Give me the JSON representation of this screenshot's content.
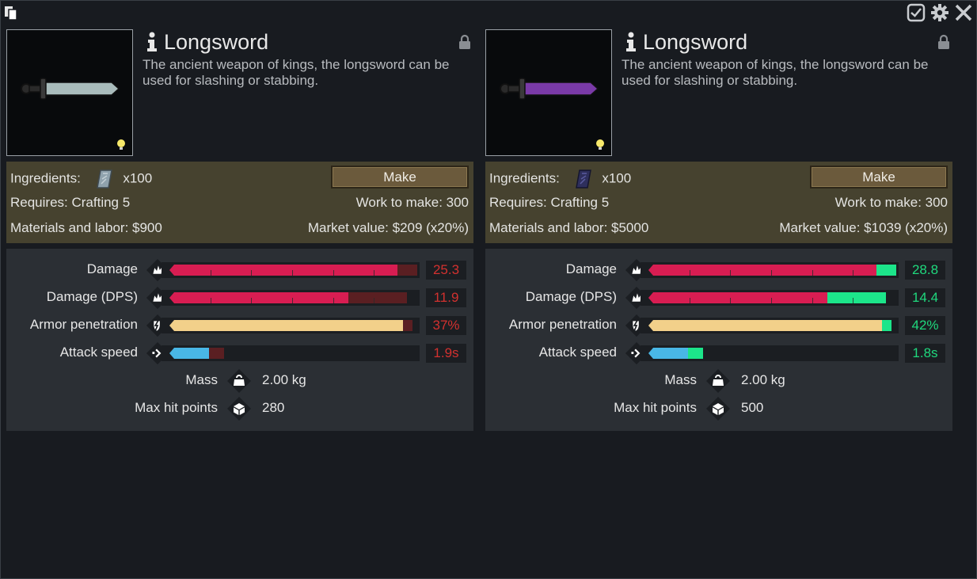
{
  "window": {
    "icons": [
      "copy-icon",
      "checklist-icon",
      "gear-icon",
      "close-icon"
    ]
  },
  "colors": {
    "damage": "#d81d52",
    "armor": "#f2d08a",
    "speed": "#49b7e6",
    "worse": "#5a1f22",
    "better": "#1ce58a",
    "worse_text": "#d2312f",
    "better_text": "#1fd87d",
    "craft_bg": "#46422f",
    "stats_bg": "#2b2f34"
  },
  "left": {
    "name": "Longsword",
    "description": "The ancient weapon of kings, the longsword can be used for slashing or stabbing.",
    "blade_color": "#a9bcbc",
    "ingredients_label": "Ingredients:",
    "ingredient_icon": "steel-icon",
    "ingredient_qty": "x100",
    "make_label": "Make",
    "requires": "Requires: Crafting 5",
    "work": "Work to make: 300",
    "materials": "Materials and labor: $900",
    "market": "Market value: $209 (x20%)",
    "stats": [
      {
        "label": "Damage",
        "icon": "damage-icon",
        "value": "25.3",
        "main": 0.93,
        "diff": 0.08,
        "diff_sign": "worse",
        "color": "damage"
      },
      {
        "label": "Damage (DPS)",
        "icon": "damage-icon",
        "value": "11.9",
        "main": 0.73,
        "diff": 0.24,
        "diff_sign": "worse",
        "color": "damage"
      },
      {
        "label": "Armor penetration",
        "icon": "armor-pen-icon",
        "value": "37%",
        "main": 0.95,
        "diff": 0.04,
        "diff_sign": "worse",
        "color": "armor"
      },
      {
        "label": "Attack speed",
        "icon": "speed-icon",
        "value": "1.9s",
        "main": 0.16,
        "diff": 0.06,
        "diff_sign": "worse",
        "color": "speed"
      }
    ],
    "misc": [
      {
        "label": "Mass",
        "icon": "weight-icon",
        "value": "2.00 kg"
      },
      {
        "label": "Max hit points",
        "icon": "hitpoints-icon",
        "value": "280"
      }
    ]
  },
  "right": {
    "name": "Longsword",
    "description": "The ancient weapon of kings, the longsword can be used for slashing or stabbing.",
    "blade_color": "#7a3aa8",
    "ingredients_label": "Ingredients:",
    "ingredient_icon": "hyperweave-icon",
    "ingredient_qty": "x100",
    "make_label": "Make",
    "requires": "Requires: Crafting 5",
    "work": "Work to make: 300",
    "materials": "Materials and labor: $5000",
    "market": "Market value: $1039 (x20%)",
    "stats": [
      {
        "label": "Damage",
        "icon": "damage-icon",
        "value": "28.8",
        "main": 0.93,
        "diff": 0.08,
        "diff_sign": "better",
        "color": "damage"
      },
      {
        "label": "Damage (DPS)",
        "icon": "damage-icon",
        "value": "14.4",
        "main": 0.73,
        "diff": 0.24,
        "diff_sign": "better",
        "color": "damage"
      },
      {
        "label": "Armor penetration",
        "icon": "armor-pen-icon",
        "value": "42%",
        "main": 0.95,
        "diff": 0.04,
        "diff_sign": "better",
        "color": "armor"
      },
      {
        "label": "Attack speed",
        "icon": "speed-icon",
        "value": "1.8s",
        "main": 0.16,
        "diff": 0.06,
        "diff_sign": "better",
        "color": "speed"
      }
    ],
    "misc": [
      {
        "label": "Mass",
        "icon": "weight-icon",
        "value": "2.00 kg"
      },
      {
        "label": "Max hit points",
        "icon": "hitpoints-icon",
        "value": "500"
      }
    ]
  }
}
